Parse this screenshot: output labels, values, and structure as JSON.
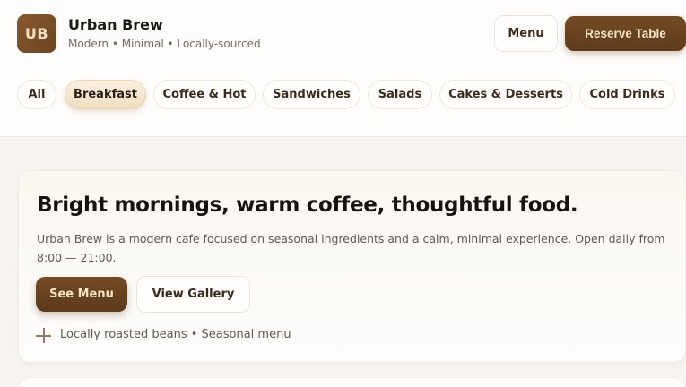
{
  "brand": {
    "logo_text": "UB",
    "name": "Urban Brew",
    "tagline": "Modern • Minimal • Locally-sourced"
  },
  "header": {
    "menu_label": "Menu",
    "reserve_label": "Reserve Table"
  },
  "categories": {
    "active": "Breakfast",
    "items": [
      "All",
      "Breakfast",
      "Coffee & Hot",
      "Sandwiches",
      "Salads",
      "Cakes & Desserts",
      "Cold Drinks"
    ]
  },
  "hero": {
    "title": "Bright mornings, warm coffee, thoughtful food.",
    "description": "Urban Brew is a modern cafe focused on seasonal ingredients and a calm, minimal experience. Open daily from 8:00 — 21:00.",
    "primary_cta": "See Menu",
    "secondary_cta": "View Gallery",
    "note": "Locally roasted beans • Seasonal menu"
  },
  "icons": {
    "note_icon": "plus-icon"
  },
  "colors": {
    "accent": "#6b4421",
    "accent_text": "#f5e3c6",
    "chip_active": "#f4e3c8",
    "background": "#f7f4f0"
  }
}
